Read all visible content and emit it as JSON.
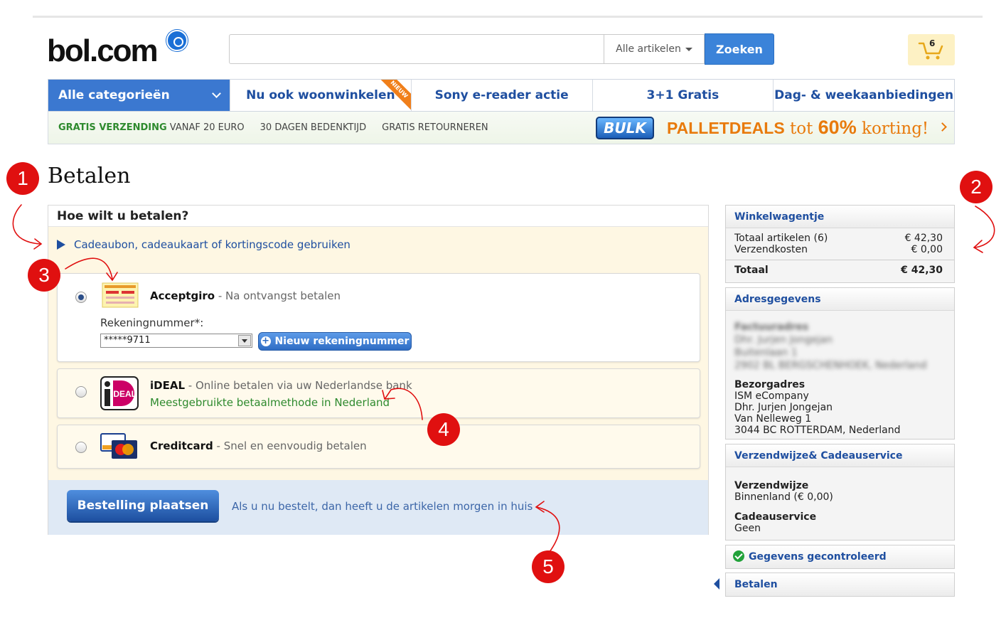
{
  "header": {
    "logo": "bol.com",
    "search_placeholder": "",
    "search_scope": "Alle artikelen",
    "search_button": "Zoeken",
    "cart_count": "6"
  },
  "nav": {
    "categories": "Alle categorieën",
    "items": [
      {
        "label": "Nu ook woonwinkelen",
        "ribbon": "NIEUW"
      },
      {
        "label": "Sony e-reader actie"
      },
      {
        "label": "3+1 Gratis"
      },
      {
        "label": "Dag- & weekaanbiedingen"
      }
    ]
  },
  "usp": {
    "shipping_bold": "GRATIS VERZENDING",
    "shipping_rest": "VANAF 20 EURO",
    "reflection": "30 DAGEN BEDENKTIJD",
    "returns": "GRATIS RETOURNEREN",
    "bulk": "BULK",
    "promo_a": "PALLETDEALS",
    "promo_b": "tot",
    "promo_pct": "60%",
    "promo_c": "korting!"
  },
  "annotations": [
    "1",
    "2",
    "3",
    "4",
    "5"
  ],
  "page_title": "Betalen",
  "payment": {
    "heading": "Hoe wilt u betalen?",
    "coupon": "Cadeaubon, cadeaukaart of kortingscode gebruiken",
    "options": [
      {
        "name": "Acceptgiro",
        "desc": " - Na ontvangst betalen",
        "selected": true
      },
      {
        "name": "iDEAL",
        "desc": " - Online betalen via uw Nederlandse bank",
        "note": "Meestgebruikte betaalmethode in Nederland"
      },
      {
        "name": "Creditcard",
        "desc": " - Snel en eenvoudig betalen"
      }
    ],
    "account_label": "Rekeningnummer*:",
    "account_value": "*****9711",
    "new_account": "Nieuw rekeningnummer",
    "ideal_logo": "iDEAL",
    "order_button": "Bestelling plaatsen",
    "order_note": "Als u nu bestelt, dan heeft u de artikelen morgen in huis"
  },
  "sidebar": {
    "cart": {
      "title": "Winkelwagentje",
      "items_label": "Totaal artikelen (6)",
      "items_value": "€ 42,30",
      "shipping_label": "Verzendkosten",
      "shipping_value": "€ 0,00",
      "total_label": "Totaal",
      "total_value": "€ 42,30"
    },
    "address": {
      "title": "Adresgegevens",
      "blurred": [
        "Factuuradres",
        "Dhr. Jurjen Jongejan",
        "Buitenlaan 1",
        "2902 BL BERGSCHENHOEK, Nederland"
      ],
      "delivery_label": "Bezorgadres",
      "delivery": [
        "ISM eCompany",
        "Dhr. Jurjen Jongejan",
        "Van Nelleweg 1",
        "3044 BC ROTTERDAM, Nederland"
      ]
    },
    "shipping": {
      "title": "Verzendwijze& Cadeauservice",
      "method_label": "Verzendwijze",
      "method_value": "Binnenland (€ 0,00)",
      "gift_label": "Cadeauservice",
      "gift_value": "Geen"
    },
    "checked": "Gegevens gecontroleerd",
    "pay_step": "Betalen"
  },
  "colors": {
    "brand": "#1f4fa0",
    "accent": "#3b78d0",
    "annotation": "#e01010",
    "promo": "#e87a0c",
    "green": "#2e8a2e"
  }
}
